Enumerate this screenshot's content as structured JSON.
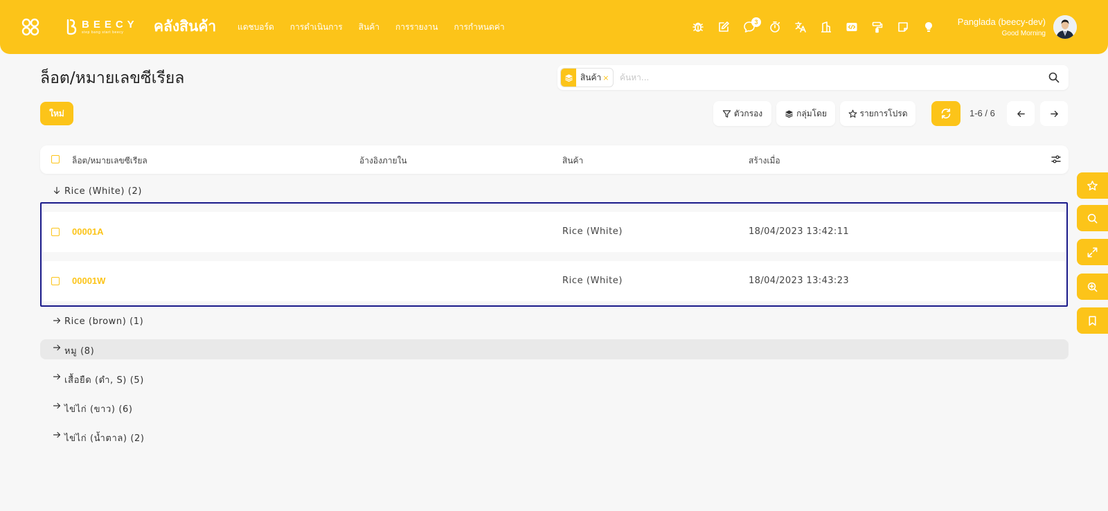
{
  "header": {
    "brand_name": "BEECY",
    "brand_tagline": "step bang start beecy",
    "app_title": "คลังสินค้า",
    "nav": [
      "แดชบอร์ด",
      "การดำเนินการ",
      "สินค้า",
      "การรายงาน",
      "การกำหนดค่า"
    ],
    "icons": [
      "bug-icon",
      "edit-icon",
      "chat-icon",
      "stopwatch-icon",
      "translate-icon",
      "building-icon",
      "code-icon",
      "paint-roller-icon",
      "note-icon",
      "lightbulb-icon"
    ],
    "chat_badge": "3",
    "user_name": "Panglada (beecy-dev)",
    "greeting": "Good Morning"
  },
  "page": {
    "title": "ล็อต/หมายเลขซีเรียล",
    "new_button": "ใหม่"
  },
  "search": {
    "facet_label": "สินค้า",
    "facet_remove": "×",
    "placeholder": "ค้นหา...",
    "value": ""
  },
  "toolbar": {
    "filter_label": "ตัวกรอง",
    "group_label": "กลุ่มโดย",
    "favorites_label": "รายการโปรด",
    "pager": "1-6 / 6"
  },
  "table": {
    "columns": [
      "ล็อต/หมายเลขซีเรียล",
      "อ้างอิงภายใน",
      "สินค้า",
      "สร้างเมื่อ"
    ],
    "groups": [
      {
        "label": "Rice (White) (2)",
        "expanded": true
      },
      {
        "label": "Rice (brown) (1)",
        "expanded": false
      },
      {
        "label": "หมู (8)",
        "expanded": false
      },
      {
        "label": "เสื้อยืด (ดำ, S) (5)",
        "expanded": false
      },
      {
        "label": "ไข่ไก่ (ขาว) (6)",
        "expanded": false
      },
      {
        "label": "ไข่ไก่ (น้ำตาล) (2)",
        "expanded": false
      }
    ],
    "rows": [
      {
        "lot": "00001A",
        "ref": "",
        "product": "Rice (White)",
        "created": "18/04/2023 13:42:11"
      },
      {
        "lot": "00001W",
        "ref": "",
        "product": "Rice (White)",
        "created": "18/04/2023 13:43:23"
      }
    ]
  },
  "side_buttons": [
    "star-icon",
    "search-icon",
    "expand-icon",
    "zoom-in-icon",
    "bookmark-icon"
  ],
  "colors": {
    "accent": "#fcc419",
    "background": "#f7f7f7",
    "selection_border": "#1a1a8a"
  }
}
